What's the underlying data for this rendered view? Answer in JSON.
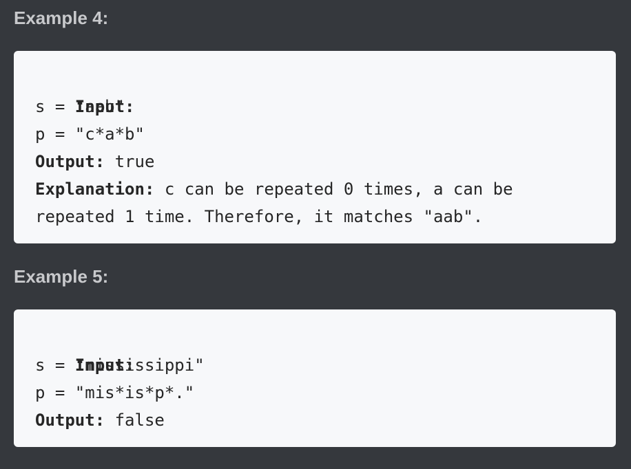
{
  "examples": [
    {
      "heading": "Example 4:",
      "input_label": "Input:",
      "s_line": "s = \"aab\"",
      "p_line": "p = \"c*a*b\"",
      "output_label": "Output:",
      "output_value": " true",
      "explanation_label": "Explanation:",
      "explanation_line1": " c can be repeated 0 times, a can be",
      "explanation_line2": "repeated 1 time. Therefore, it matches \"aab\"."
    },
    {
      "heading": "Example 5:",
      "input_label": "Input:",
      "s_line": "s = \"mississippi\"",
      "p_line": "p = \"mis*is*p*.\"",
      "output_label": "Output:",
      "output_value": " false"
    }
  ]
}
